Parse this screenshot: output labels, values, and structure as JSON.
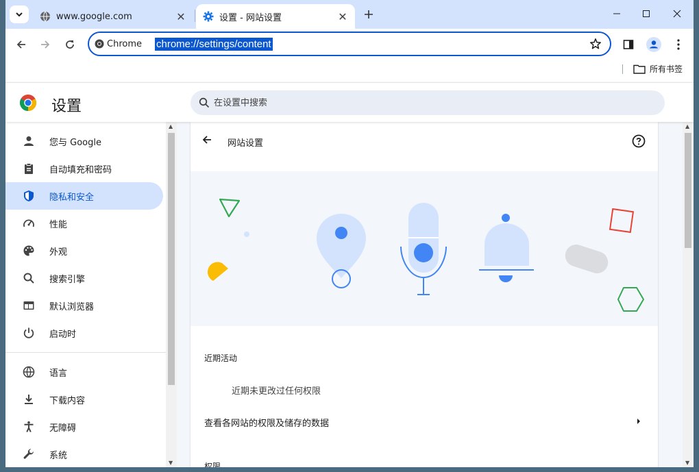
{
  "tabs": [
    {
      "title": "www.google.com",
      "active": false
    },
    {
      "title": "设置 - 网站设置",
      "active": true
    }
  ],
  "omnibox": {
    "chip_label": "Chrome",
    "url": "chrome://settings/content"
  },
  "bookmarks": {
    "all_bookmarks_label": "所有书签"
  },
  "settings": {
    "title": "设置",
    "search_placeholder": "在设置中搜索"
  },
  "sidebar": {
    "items": [
      {
        "label": "您与 Google",
        "icon": "person-icon",
        "selected": false
      },
      {
        "label": "自动填充和密码",
        "icon": "clipboard-icon",
        "selected": false
      },
      {
        "label": "隐私和安全",
        "icon": "shield-icon",
        "selected": true
      },
      {
        "label": "性能",
        "icon": "speedometer-icon",
        "selected": false
      },
      {
        "label": "外观",
        "icon": "palette-icon",
        "selected": false
      },
      {
        "label": "搜索引擎",
        "icon": "search-icon",
        "selected": false
      },
      {
        "label": "默认浏览器",
        "icon": "browser-window-icon",
        "selected": false
      },
      {
        "label": "启动时",
        "icon": "power-icon",
        "selected": false
      },
      {
        "label": "语言",
        "icon": "globe-icon",
        "selected": false
      },
      {
        "label": "下载内容",
        "icon": "download-icon",
        "selected": false
      },
      {
        "label": "无障碍",
        "icon": "accessibility-icon",
        "selected": false
      },
      {
        "label": "系统",
        "icon": "wrench-icon",
        "selected": false
      }
    ]
  },
  "main": {
    "page_title": "网站设置",
    "recent_activity_title": "近期活动",
    "recent_activity_empty": "近期未更改过任何权限",
    "view_permissions_link": "查看各网站的权限及储存的数据",
    "permissions_title": "权限"
  },
  "colors": {
    "accent": "#0b57d0",
    "selected_bg": "#d3e3fd",
    "tabstrip_bg": "#d3e3fd",
    "search_bg": "#e9eef6",
    "illustration_blue": "#d3e3fd",
    "illustration_dark_blue": "#4285f4"
  }
}
